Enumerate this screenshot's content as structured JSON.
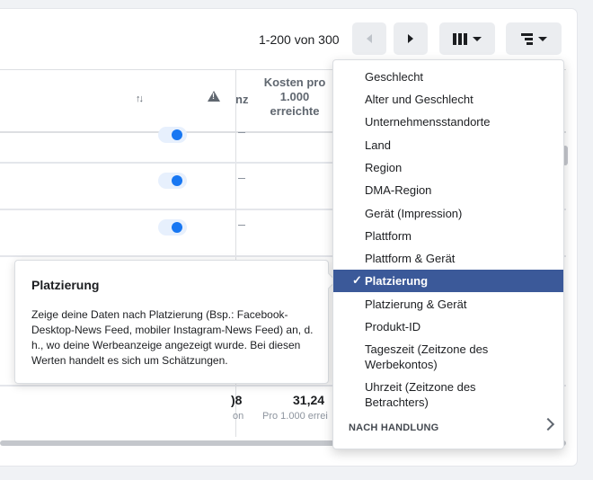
{
  "toolbar": {
    "pagination": "1-200 von 300",
    "prev_icon": "triangle-left",
    "next_icon": "triangle-right",
    "columns_icon": "columns-icon",
    "breakdown_icon": "breakdown-icon"
  },
  "table": {
    "header_partial": "nz",
    "header_cost": "Kosten pro 1.000 erreichte",
    "footer_value_1": ")8",
    "footer_sub_1": "on",
    "footer_value_2": "31,24",
    "footer_sub_2": "Pro 1.000 errei"
  },
  "tooltip": {
    "title": "Platzierung",
    "body": "Zeige deine Daten nach Platzierung (Bsp.: Facebook-Desktop-News Feed, mobiler Instagram-News Feed) an, d. h., wo deine Werbeanzeige angezeigt wurde. Bei diesen Werten handelt es sich um Schätzungen."
  },
  "menu": {
    "items": [
      "Geschlecht",
      "Alter und Geschlecht",
      "Unternehmensstandorte",
      "Land",
      "Region",
      "DMA-Region",
      "Gerät (Impression)",
      "Plattform",
      "Plattform & Gerät",
      "Platzierung",
      "Platzierung & Gerät",
      "Produkt-ID",
      "Tageszeit (Zeitzone des Werbekontos)",
      "Uhrzeit (Zeitzone des Betrachters)"
    ],
    "selected": "Platzierung",
    "section": "NACH HANDLUNG"
  },
  "colors": {
    "selected_bg": "#3b5999",
    "toggle_on": "#1877f2"
  }
}
